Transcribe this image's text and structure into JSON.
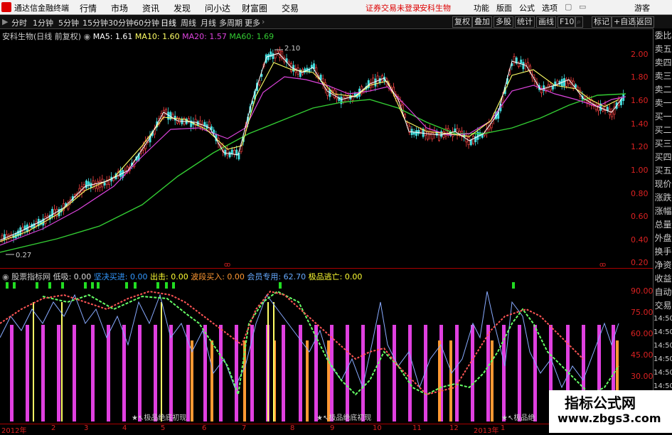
{
  "menubar": {
    "app_name": "通达信金融终端",
    "menus": [
      "行情",
      "市场",
      "资讯",
      "发现",
      "问小达",
      "财富圈",
      "交易"
    ],
    "notice": "证券交易未登录",
    "stock": "安科生物",
    "right_menus": [
      "功能",
      "版面",
      "公式",
      "选项"
    ],
    "window_label": "游客"
  },
  "periodbar": {
    "periods": [
      "分时",
      "1分钟",
      "5分钟",
      "15分钟",
      "30分钟",
      "60分钟",
      "日线",
      "周线",
      "月线",
      "多周期",
      "更多"
    ],
    "active": "日线",
    "tools": [
      "复权",
      "叠加",
      "多股",
      "统计",
      "画线",
      "F10",
      "标记",
      "+自选",
      "返回"
    ]
  },
  "price_panel": {
    "title": "安科生物(日线 前复权)",
    "ma": [
      {
        "label": "MA5: 1.61",
        "color": "#ffffff"
      },
      {
        "label": "MA10: 1.60",
        "color": "#ffff66"
      },
      {
        "label": "MA20: 1.57",
        "color": "#dd44dd"
      },
      {
        "label": "MA60: 1.69",
        "color": "#33cc33"
      }
    ],
    "high_label": "2.10",
    "low_label": "0.27",
    "axis_ticks": [
      "2.00",
      "1.80",
      "1.60",
      "1.40",
      "1.20",
      "1.00",
      "0.80",
      "0.60",
      "0.40",
      "0.20"
    ]
  },
  "indicator_panel": {
    "title": "股票指标网",
    "items": [
      {
        "label": "低吸: 0.00",
        "color": "#dddddd"
      },
      {
        "label": "坚决买进: 0.00",
        "color": "#3399ff"
      },
      {
        "label": "出击: 0.00",
        "color": "#ffff33"
      },
      {
        "label": "波段买入: 0.00",
        "color": "#ff9933"
      },
      {
        "label": "会员专用: 62.70",
        "color": "#66aaff"
      },
      {
        "label": "极品逃亡: 0.00",
        "color": "#ffff33"
      }
    ],
    "axis_ticks": [
      "90.00",
      "75.00",
      "60.00",
      "45.00",
      "30.00"
    ],
    "arrow_label": "极品绝底初现",
    "arrow_label_short": "极品绝"
  },
  "datebar": {
    "labels": [
      "2012年",
      "2",
      "3",
      "4",
      "5",
      "6",
      "7",
      "8",
      "9",
      "10",
      "11",
      "12",
      "2013年",
      "1"
    ]
  },
  "right_panel": {
    "items": [
      "委比",
      "卖五",
      "卖四",
      "卖三",
      "卖二",
      "卖一",
      "买一",
      "买二",
      "买三",
      "买四",
      "买五",
      "现价",
      "涨跌",
      "涨幅",
      "总量",
      "外盘",
      "换手",
      "净资",
      "收益",
      "自动",
      "交易",
      "14:50",
      "14:50",
      "14:50",
      "14:50",
      "14:50",
      "14:50",
      "14:50",
      "14:50"
    ]
  },
  "watermark": {
    "title": "指标公式网",
    "url": "www.zbgs3.com"
  }
}
